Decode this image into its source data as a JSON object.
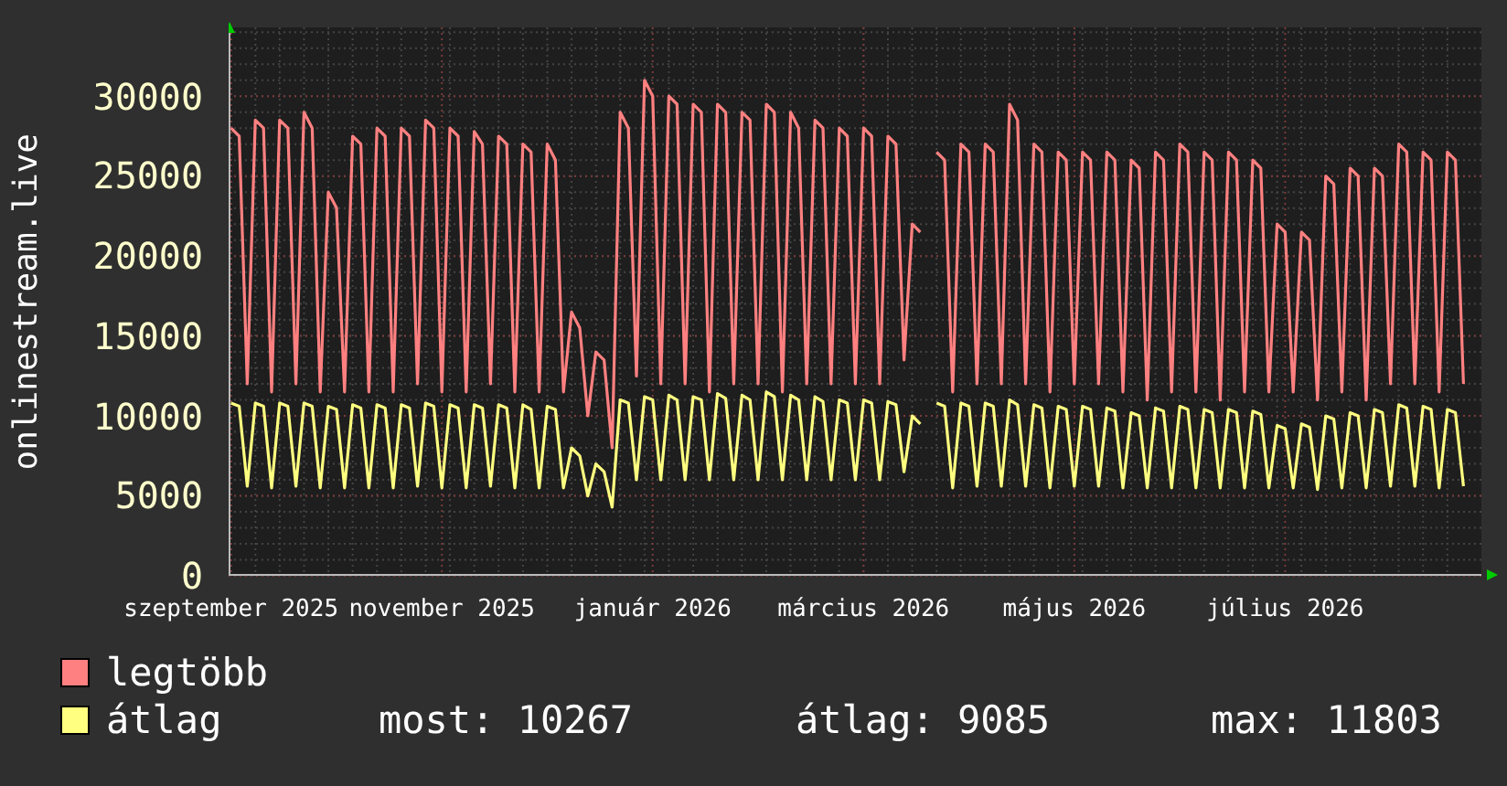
{
  "chart": {
    "y_axis_title": "onlinestream.live",
    "chart_data": {
      "type": "line",
      "grid": true,
      "ylim": [
        0,
        34300
      ],
      "yticks": [
        0,
        5000,
        10000,
        15000,
        20000,
        25000,
        30000
      ],
      "categories": [
        "szeptember 2025",
        null,
        null,
        null,
        null,
        null,
        null,
        null,
        null,
        null,
        null,
        null,
        null,
        null,
        null,
        null,
        null,
        null,
        null,
        null,
        null,
        null,
        null,
        null,
        null,
        null,
        "november 2025",
        null,
        null,
        null,
        null,
        null,
        null,
        null,
        null,
        null,
        null,
        null,
        null,
        null,
        null,
        null,
        null,
        null,
        null,
        null,
        null,
        null,
        null,
        null,
        null,
        null,
        "január 2026",
        null,
        null,
        null,
        null,
        null,
        null,
        null,
        null,
        null,
        null,
        null,
        null,
        null,
        null,
        null,
        null,
        null,
        null,
        null,
        null,
        null,
        null,
        null,
        null,
        null,
        "március 2026",
        null,
        null,
        null,
        null,
        null,
        null,
        null,
        null,
        null,
        null,
        null,
        null,
        null,
        null,
        null,
        null,
        null,
        null,
        null,
        null,
        null,
        null,
        null,
        null,
        null,
        "május 2026",
        null,
        null,
        null,
        null,
        null,
        null,
        null,
        null,
        null,
        null,
        null,
        null,
        null,
        null,
        null,
        null,
        null,
        null,
        null,
        null,
        null,
        null,
        null,
        null,
        null,
        "július 2026",
        null,
        null,
        null,
        null,
        null,
        null,
        null,
        null,
        null,
        null,
        null,
        null,
        null,
        null,
        null,
        null,
        null,
        null,
        null,
        null,
        null,
        null
      ],
      "series": [
        {
          "name": "legtöbb",
          "color": "#ff8080",
          "values": [
            28000,
            27500,
            12000,
            28500,
            28000,
            11500,
            28500,
            28000,
            12000,
            29000,
            28000,
            11500,
            24000,
            23000,
            11500,
            27500,
            27000,
            11500,
            28000,
            27500,
            11500,
            28000,
            27500,
            12000,
            28500,
            28000,
            11500,
            28000,
            27500,
            11500,
            27800,
            27000,
            12000,
            27500,
            27000,
            11500,
            27000,
            26500,
            11500,
            27000,
            26000,
            11500,
            16500,
            15500,
            10000,
            14000,
            13500,
            8000,
            29000,
            28000,
            12500,
            31000,
            30000,
            12000,
            30000,
            29500,
            12000,
            29500,
            29000,
            11500,
            29500,
            29000,
            12000,
            29000,
            28500,
            12000,
            29500,
            29000,
            11500,
            29000,
            28000,
            12000,
            28500,
            28000,
            12000,
            28000,
            27500,
            12000,
            28000,
            27500,
            12000,
            27500,
            27000,
            13500,
            22000,
            21500,
            null,
            26500,
            26000,
            11500,
            27000,
            26500,
            12000,
            27000,
            26500,
            12000,
            29500,
            28500,
            12000,
            27000,
            26500,
            11500,
            26500,
            26000,
            12000,
            26500,
            26000,
            12000,
            26500,
            26000,
            11500,
            26000,
            25500,
            11000,
            26500,
            26000,
            11500,
            27000,
            26500,
            11500,
            26500,
            26000,
            11000,
            26500,
            26000,
            11500,
            26000,
            25500,
            11500,
            22000,
            21500,
            11500,
            21500,
            21000,
            11000,
            25000,
            24500,
            11500,
            25500,
            25000,
            11000,
            25500,
            25000,
            12000,
            27000,
            26500,
            12000,
            26500,
            26000,
            11500,
            26500,
            26000,
            12000
          ]
        },
        {
          "name": "átlag",
          "color": "#ffff80",
          "values": [
            10800,
            10600,
            5600,
            10800,
            10600,
            5500,
            10800,
            10600,
            5600,
            10800,
            10600,
            5500,
            10600,
            10400,
            5500,
            10700,
            10500,
            5500,
            10700,
            10500,
            5500,
            10700,
            10500,
            5600,
            10800,
            10600,
            5500,
            10700,
            10500,
            5500,
            10700,
            10500,
            5600,
            10700,
            10500,
            5500,
            10700,
            10400,
            5500,
            10600,
            10400,
            5500,
            8000,
            7500,
            5000,
            7000,
            6500,
            4300,
            11000,
            10800,
            6000,
            11200,
            11000,
            6000,
            11300,
            11000,
            6000,
            11200,
            11000,
            6000,
            11400,
            11100,
            6000,
            11300,
            11000,
            6000,
            11500,
            11200,
            6000,
            11300,
            11000,
            6000,
            11200,
            10900,
            6000,
            11000,
            10800,
            6000,
            11000,
            10800,
            6000,
            10900,
            10700,
            6500,
            10000,
            9500,
            null,
            10800,
            10600,
            5500,
            10800,
            10600,
            5600,
            10800,
            10600,
            5600,
            11000,
            10700,
            5600,
            10700,
            10500,
            5500,
            10600,
            10400,
            5600,
            10600,
            10400,
            5600,
            10500,
            10300,
            5500,
            10200,
            10000,
            5500,
            10500,
            10300,
            5500,
            10600,
            10400,
            5500,
            10400,
            10200,
            5500,
            10400,
            10200,
            5500,
            10300,
            10100,
            5500,
            9400,
            9200,
            5500,
            9500,
            9300,
            5400,
            10000,
            9800,
            5500,
            10200,
            10000,
            5500,
            10400,
            10200,
            5600,
            10700,
            10500,
            5600,
            10600,
            10400,
            5500,
            10400,
            10200,
            5600
          ]
        }
      ]
    }
  },
  "legend": {
    "stats": [
      "most: 10267",
      "átlag: 9085",
      "max: 11803"
    ]
  }
}
